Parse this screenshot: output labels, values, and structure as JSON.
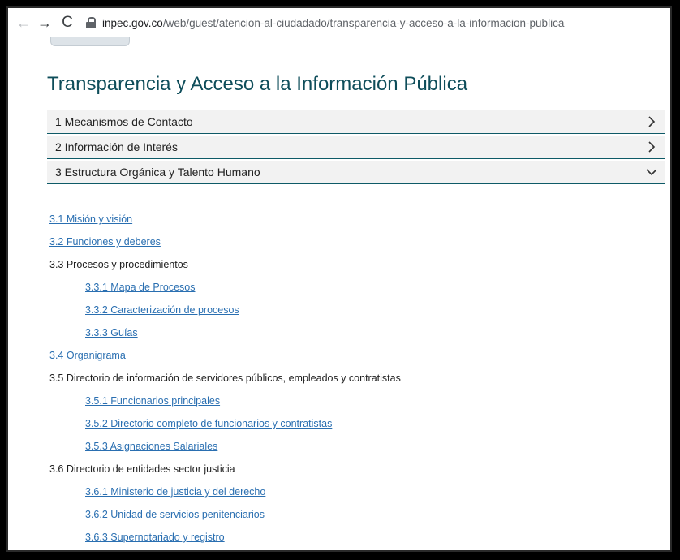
{
  "browser": {
    "url_domain": "inpec.gov.co",
    "url_path": "/web/guest/atencion-al-ciudadado/transparencia-y-acceso-a-la-informacion-publica",
    "back_icon": "←",
    "forward_icon": "→",
    "reload_icon": "C"
  },
  "page": {
    "title": "Transparencia y Acceso a la Información Pública"
  },
  "accordion": {
    "items": [
      {
        "label": "1 Mecanismos de Contacto",
        "chevron": "right"
      },
      {
        "label": "2 Información de Interés",
        "chevron": "right"
      },
      {
        "label": "3 Estructura Orgánica y Talento Humano",
        "chevron": "down"
      }
    ]
  },
  "content": {
    "items": [
      {
        "label": "3.1 Misión y visión",
        "link": true,
        "indent": false
      },
      {
        "label": "3.2 Funciones y deberes",
        "link": true,
        "indent": false
      },
      {
        "label": "3.3 Procesos y procedimientos",
        "link": false,
        "indent": false
      },
      {
        "label": "3.3.1 Mapa de Procesos",
        "link": true,
        "indent": true
      },
      {
        "label": "3.3.2 Caracterización de procesos",
        "link": true,
        "indent": true
      },
      {
        "label": "3.3.3 Guías",
        "link": true,
        "indent": true
      },
      {
        "label": "3.4 Organigrama",
        "link": true,
        "indent": false
      },
      {
        "label": "3.5 Directorio de información de servidores públicos, empleados y contratistas",
        "link": false,
        "indent": false
      },
      {
        "label": "3.5.1 Funcionarios principales",
        "link": true,
        "indent": true
      },
      {
        "label": "3.5.2 Directorio completo de funcionarios y contratistas",
        "link": true,
        "indent": true
      },
      {
        "label": "3.5.3 Asignaciones Salariales",
        "link": true,
        "indent": true
      },
      {
        "label": "3.6 Directorio de entidades sector justicia",
        "link": false,
        "indent": false
      },
      {
        "label": "3.6.1 Ministerio de justicia y del derecho",
        "link": true,
        "indent": true
      },
      {
        "label": "3.6.2 Unidad de servicios penitenciarios",
        "link": true,
        "indent": true
      },
      {
        "label": "3.6.3 Supernotariado y registro",
        "link": true,
        "indent": true
      }
    ]
  }
}
